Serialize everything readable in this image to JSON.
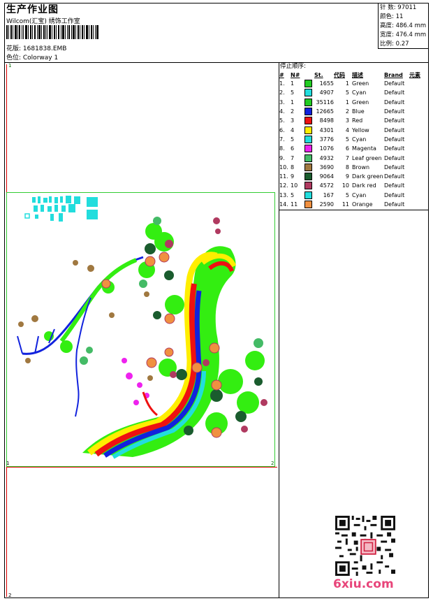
{
  "header": {
    "title": "生产作业图",
    "company": "Wilcom(汇宝) 绣饰工作室",
    "design": "花版: 1681838.EMB",
    "colorway": "色位: Colorway 1"
  },
  "stats": [
    {
      "label": "针 数:",
      "value": "97011"
    },
    {
      "label": "颜色:",
      "value": "11"
    },
    {
      "label": "高度:",
      "value": "486.4 mm"
    },
    {
      "label": "宽度:",
      "value": "476.4 mm"
    },
    {
      "label": "比例:",
      "value": "0.27"
    }
  ],
  "stop_sequence": {
    "title": "停止顺序:",
    "headers": [
      "#",
      "N#",
      "St.",
      "代码",
      "描述",
      "Brand",
      "元素"
    ],
    "rows": [
      {
        "idx": "1.",
        "n": "1",
        "color": "#22cc22",
        "st": "1655",
        "code": "1",
        "desc": "Green",
        "brand": "Default"
      },
      {
        "idx": "2.",
        "n": "5",
        "color": "#22dddd",
        "st": "4907",
        "code": "5",
        "desc": "Cyan",
        "brand": "Default"
      },
      {
        "idx": "3.",
        "n": "1",
        "color": "#22cc22",
        "st": "35116",
        "code": "1",
        "desc": "Green",
        "brand": "Default"
      },
      {
        "idx": "4.",
        "n": "2",
        "color": "#1122dd",
        "st": "12665",
        "code": "2",
        "desc": "Blue",
        "brand": "Default"
      },
      {
        "idx": "5.",
        "n": "3",
        "color": "#ee1111",
        "st": "8498",
        "code": "3",
        "desc": "Red",
        "brand": "Default"
      },
      {
        "idx": "6.",
        "n": "4",
        "color": "#ffee00",
        "st": "4301",
        "code": "4",
        "desc": "Yellow",
        "brand": "Default"
      },
      {
        "idx": "7.",
        "n": "5",
        "color": "#22dddd",
        "st": "3776",
        "code": "5",
        "desc": "Cyan",
        "brand": "Default"
      },
      {
        "idx": "8.",
        "n": "6",
        "color": "#ee22ee",
        "st": "1076",
        "code": "6",
        "desc": "Magenta",
        "brand": "Default"
      },
      {
        "idx": "9.",
        "n": "7",
        "color": "#44bb66",
        "st": "4932",
        "code": "7",
        "desc": "Leaf green",
        "brand": "Default"
      },
      {
        "idx": "10.",
        "n": "8",
        "color": "#a07840",
        "st": "3690",
        "code": "8",
        "desc": "Brown",
        "brand": "Default"
      },
      {
        "idx": "11.",
        "n": "9",
        "color": "#1a5c2e",
        "st": "9064",
        "code": "9",
        "desc": "Dark green",
        "brand": "Default"
      },
      {
        "idx": "12.",
        "n": "10",
        "color": "#b03a60",
        "st": "4572",
        "code": "10",
        "desc": "Dark red",
        "brand": "Default"
      },
      {
        "idx": "13.",
        "n": "5",
        "color": "#22dddd",
        "st": "167",
        "code": "5",
        "desc": "Cyan",
        "brand": "Default"
      },
      {
        "idx": "14.",
        "n": "11",
        "color": "#f09040",
        "st": "2590",
        "code": "11",
        "desc": "Orange",
        "brand": "Default"
      }
    ]
  },
  "canvas": {
    "corner_labels": [
      "1",
      "2",
      "1",
      "2"
    ]
  },
  "watermark": "6xiu.com"
}
